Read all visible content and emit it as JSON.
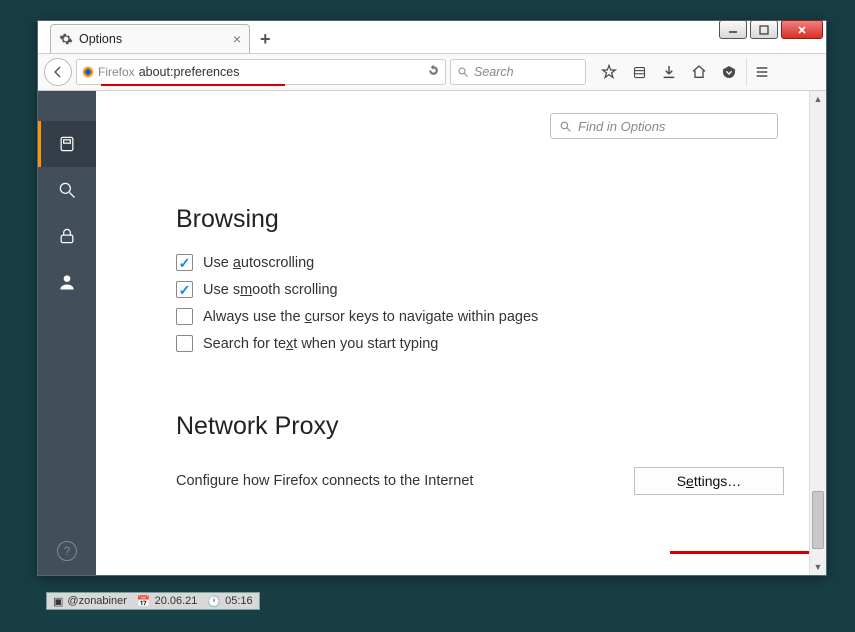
{
  "tab": {
    "title": "Options"
  },
  "url": {
    "identity": "Firefox",
    "value": "about:preferences"
  },
  "search": {
    "placeholder": "Search"
  },
  "find": {
    "placeholder": "Find in Options"
  },
  "sections": {
    "browsing": {
      "title": "Browsing",
      "opts": [
        {
          "checked": true,
          "pre": "Use ",
          "u": "a",
          "post": "utoscrolling"
        },
        {
          "checked": true,
          "pre": "Use s",
          "u": "m",
          "post": "ooth scrolling"
        },
        {
          "checked": false,
          "pre": "Always use the ",
          "u": "c",
          "post": "ursor keys to navigate within pages"
        },
        {
          "checked": false,
          "pre": "Search for te",
          "u": "x",
          "post": "t when you start typing"
        }
      ]
    },
    "proxy": {
      "title": "Network Proxy",
      "desc": "Configure how Firefox connects to the Internet",
      "button_pre": "S",
      "button_u": "e",
      "button_post": "ttings…"
    }
  },
  "taskbar": {
    "user": "@zonabiner",
    "date": "20.06.21",
    "time": "05:16"
  }
}
